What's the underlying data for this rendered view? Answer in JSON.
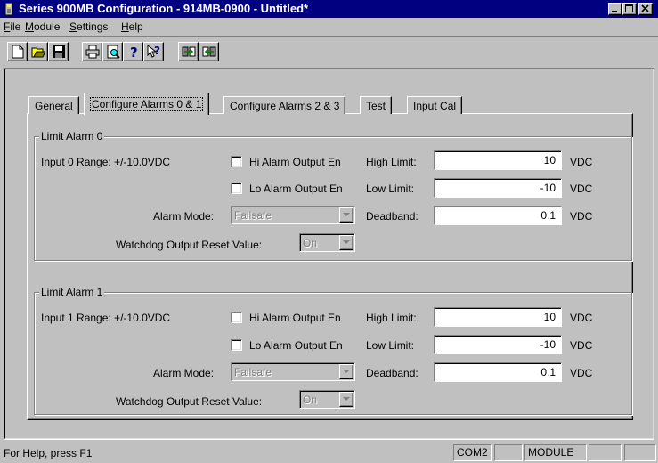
{
  "window": {
    "title": "Series 900MB Configuration - 914MB-0900 - Untitled*",
    "app_icon": "module-icon",
    "controls": [
      "minimize-icon",
      "maximize-icon",
      "close-icon"
    ]
  },
  "menu": {
    "items": [
      {
        "accel": "F",
        "rest": "ile"
      },
      {
        "accel": "M",
        "rest": "odule"
      },
      {
        "accel": "S",
        "rest": "ettings"
      },
      {
        "accel": "H",
        "rest": "elp"
      }
    ]
  },
  "toolbar": {
    "buttons": [
      "new-icon",
      "open-icon",
      "save-icon",
      "print-icon",
      "print-preview-icon",
      "help-icon",
      "context-help-icon",
      "upload-icon",
      "download-icon"
    ]
  },
  "tabs": [
    {
      "label": "General",
      "active": false
    },
    {
      "label": "Configure Alarms 0 & 1",
      "active": true
    },
    {
      "label": "Configure Alarms 2 & 3",
      "active": false
    },
    {
      "label": "Test",
      "active": false
    },
    {
      "label": "Input Cal",
      "active": false
    }
  ],
  "alarms": [
    {
      "title": "Limit Alarm 0",
      "range_label": "Input 0 Range: +/-10.0VDC",
      "hi_enable_label": "Hi Alarm Output En",
      "hi_enable_checked": false,
      "lo_enable_label": "Lo Alarm Output En",
      "lo_enable_checked": false,
      "high_limit_label": "High Limit:",
      "high_limit_value": "10",
      "low_limit_label": "Low Limit:",
      "low_limit_value": "-10",
      "deadband_label": "Deadband:",
      "deadband_value": "0.1",
      "unit": "VDC",
      "mode_label": "Alarm Mode:",
      "mode_value": "Failsafe",
      "watchdog_label": "Watchdog Output Reset Value:",
      "watchdog_value": "On"
    },
    {
      "title": "Limit Alarm 1",
      "range_label": "Input 1 Range: +/-10.0VDC",
      "hi_enable_label": "Hi Alarm Output En",
      "hi_enable_checked": false,
      "lo_enable_label": "Lo Alarm Output En",
      "lo_enable_checked": false,
      "high_limit_label": "High Limit:",
      "high_limit_value": "10",
      "low_limit_label": "Low Limit:",
      "low_limit_value": "-10",
      "deadband_label": "Deadband:",
      "deadband_value": "0.1",
      "unit": "VDC",
      "mode_label": "Alarm Mode:",
      "mode_value": "Failsafe",
      "watchdog_label": "Watchdog Output Reset Value:",
      "watchdog_value": "On"
    }
  ],
  "status": {
    "help_text": "For Help, press F1",
    "port": "COM2",
    "device": "MODULE"
  },
  "colors": {
    "face": "#c0c0c0",
    "titlebar": "#000080",
    "shadow": "#808080",
    "highlight": "#ffffff"
  }
}
